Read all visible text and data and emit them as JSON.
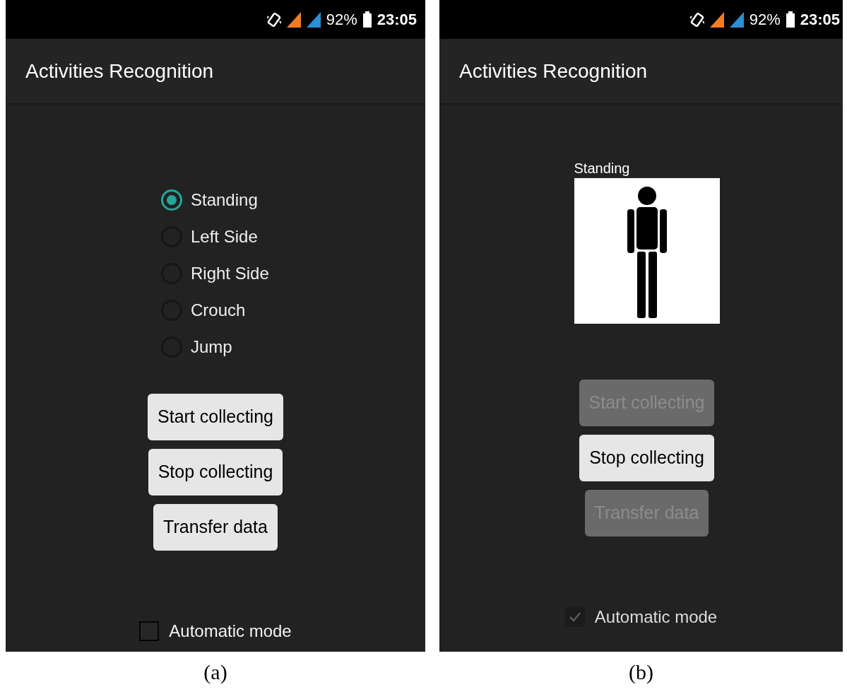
{
  "panels": [
    {
      "kind": "selection",
      "caption": "(a)",
      "status_bar": {
        "battery": "92%",
        "time": "23:05"
      },
      "title": "Activities Recognition",
      "activities": [
        {
          "label": "Standing",
          "selected": true
        },
        {
          "label": "Left Side",
          "selected": false
        },
        {
          "label": "Right Side",
          "selected": false
        },
        {
          "label": "Crouch",
          "selected": false
        },
        {
          "label": "Jump",
          "selected": false
        }
      ],
      "buttons": [
        {
          "label": "Start collecting",
          "disabled": false
        },
        {
          "label": "Stop collecting",
          "disabled": false
        },
        {
          "label": "Transfer data",
          "disabled": false
        }
      ],
      "automatic_mode": {
        "label": "Automatic mode",
        "checked": false,
        "disabled": false
      }
    },
    {
      "kind": "display",
      "caption": "(b)",
      "status_bar": {
        "battery": "92%",
        "time": "23:05"
      },
      "title": "Activities Recognition",
      "current_activity": "Standing",
      "buttons": [
        {
          "label": "Start collecting",
          "disabled": true
        },
        {
          "label": "Stop collecting",
          "disabled": false
        },
        {
          "label": "Transfer data",
          "disabled": true
        }
      ],
      "automatic_mode": {
        "label": "Automatic mode",
        "checked": true,
        "disabled": true
      }
    }
  ]
}
